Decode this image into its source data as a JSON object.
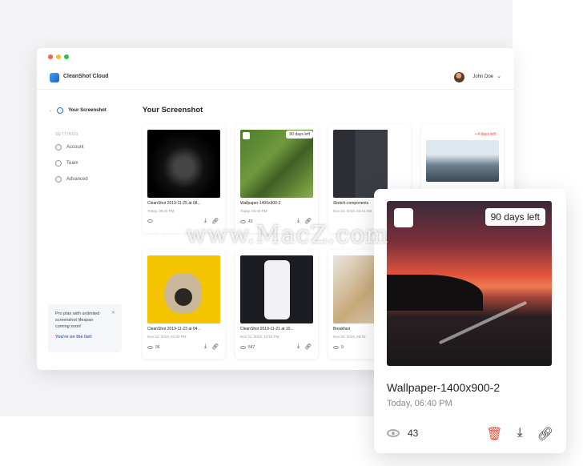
{
  "app": {
    "title": "CleanShot Cloud",
    "user_name": "John Doe"
  },
  "sidebar": {
    "active_item": "Your Screenshot",
    "settings_label": "SETTINGS",
    "items": [
      {
        "label": "Account",
        "icon": "account-icon"
      },
      {
        "label": "Team",
        "icon": "team-icon"
      },
      {
        "label": "Advanced",
        "icon": "advanced-icon"
      }
    ],
    "promo": {
      "text": "Pro plan with unlimited screenshot lifespan coming soon!",
      "link": "You're on the list!"
    }
  },
  "main": {
    "title": "Your Screenshot",
    "cards": [
      {
        "name": "CleanShot 2019-11-25 at 08...",
        "date": "Today, 09:20 PM",
        "views": ""
      },
      {
        "name": "Wallpaper-1400x900-2",
        "date": "Today, 06:40 PM",
        "views": "43",
        "badge": "90 days left"
      },
      {
        "name": "Sketch-components",
        "date": "Nov 24, 2019, 03:11 AM",
        "views": ""
      },
      {
        "name": "",
        "date": "",
        "views": "",
        "badge": "4 days left"
      },
      {
        "name": "CleanShot 2019-11-23 at 04...",
        "date": "Nov 23, 2019, 04:00 PM",
        "views": "96"
      },
      {
        "name": "CleanShot 2019-11-21 at 10...",
        "date": "Nov 21, 2019, 10:50 PM",
        "views": "547"
      },
      {
        "name": "Breakfast",
        "date": "Nov 20, 2019, 08:33",
        "views": "9"
      }
    ]
  },
  "detail": {
    "badge": "90 days left",
    "name": "Wallpaper-1400x900-2",
    "date": "Today, 06:40 PM",
    "views": "43"
  },
  "watermark": "www.MacZ.com"
}
